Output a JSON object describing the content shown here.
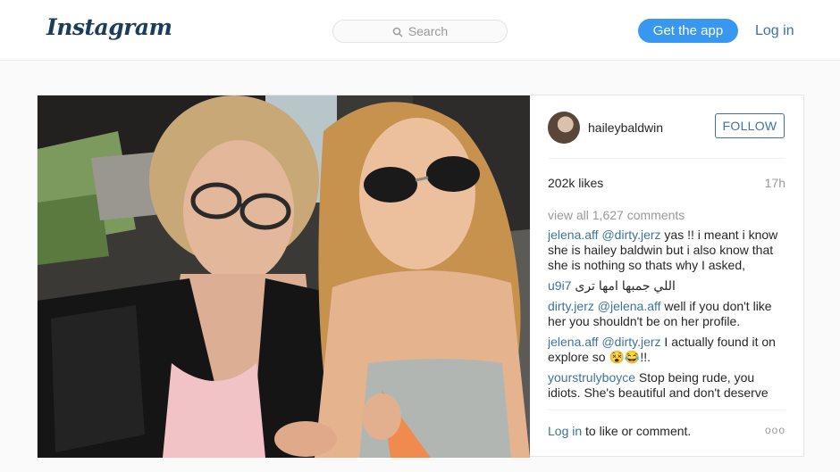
{
  "header": {
    "logo": "Instagram",
    "search_placeholder": "Search",
    "get_app_label": "Get the app",
    "login_label": "Log in"
  },
  "post": {
    "username": "haileybaldwin",
    "follow_label": "FOLLOW",
    "likes": "202k likes",
    "age": "17h",
    "view_all": "view all 1,627 comments",
    "comments": [
      {
        "user": "jelena.aff",
        "mention": "@dirty.jerz",
        "text": " yas !! i meant i know she is hailey baldwin but i also know that she is nothing so thats why I asked,"
      },
      {
        "user": "u9i7",
        "mention": "",
        "text": " اللي جمبها امها ترى"
      },
      {
        "user": "dirty.jerz",
        "mention": "@jelena.aff",
        "text": " well if you don't like her you shouldn't be on her profile."
      },
      {
        "user": "jelena.aff",
        "mention": "@dirty.jerz",
        "text": " I actually found it on explore so 😵😂!!."
      },
      {
        "user": "yourstrulyboyce",
        "mention": "",
        "text": " Stop being rude, you idiots. She's beautiful and don't deserve these"
      }
    ],
    "login_link": "Log in",
    "login_suffix": " to like or comment.",
    "more_label": "ooo"
  }
}
